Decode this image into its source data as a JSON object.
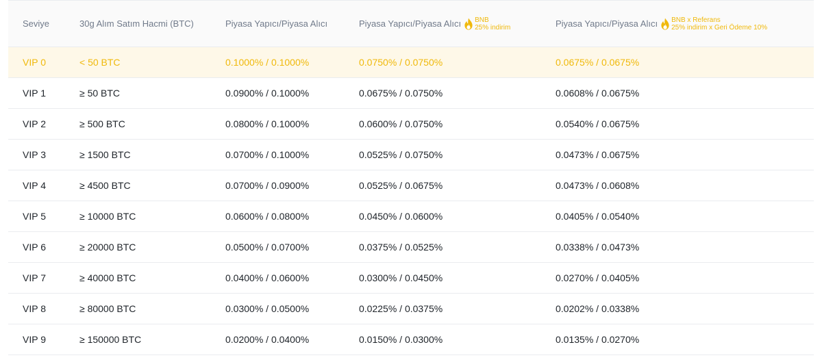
{
  "header": {
    "level": "Seviye",
    "volume": "30g Alım Satım Hacmi (BTC)",
    "maker_taker": "Piyasa Yapıcı/Piyasa Alıcı",
    "maker_taker_bnb": "Piyasa Yapıcı/Piyasa Alıcı",
    "bnb_badge_line1": "BNB",
    "bnb_badge_line2": "25% indirim",
    "maker_taker_ref": "Piyasa Yapıcı/Piyasa Alıcı",
    "ref_badge_line1": "BNB x Referans",
    "ref_badge_line2": "25% indirim x Geri Ödeme 10%"
  },
  "colors": {
    "highlight_bg": "#fef8e8",
    "accent": "#f0b90b",
    "muted": "#707a8a"
  },
  "icons": {
    "badge": "fire-icon"
  },
  "rows": [
    {
      "level": "VIP 0",
      "volume": "< 50 BTC",
      "fee": "0.1000% / 0.1000%",
      "bnb": "0.0750% / 0.0750%",
      "ref": "0.0675% / 0.0675%"
    },
    {
      "level": "VIP 1",
      "volume": "≥ 50 BTC",
      "fee": "0.0900% / 0.1000%",
      "bnb": "0.0675% / 0.0750%",
      "ref": "0.0608% / 0.0675%"
    },
    {
      "level": "VIP 2",
      "volume": "≥ 500 BTC",
      "fee": "0.0800% / 0.1000%",
      "bnb": "0.0600% / 0.0750%",
      "ref": "0.0540% / 0.0675%"
    },
    {
      "level": "VIP 3",
      "volume": "≥ 1500 BTC",
      "fee": "0.0700% / 0.1000%",
      "bnb": "0.0525% / 0.0750%",
      "ref": "0.0473% / 0.0675%"
    },
    {
      "level": "VIP 4",
      "volume": "≥ 4500 BTC",
      "fee": "0.0700% / 0.0900%",
      "bnb": "0.0525% / 0.0675%",
      "ref": "0.0473% / 0.0608%"
    },
    {
      "level": "VIP 5",
      "volume": "≥ 10000 BTC",
      "fee": "0.0600% / 0.0800%",
      "bnb": "0.0450% / 0.0600%",
      "ref": "0.0405% / 0.0540%"
    },
    {
      "level": "VIP 6",
      "volume": "≥ 20000 BTC",
      "fee": "0.0500% / 0.0700%",
      "bnb": "0.0375% / 0.0525%",
      "ref": "0.0338% / 0.0473%"
    },
    {
      "level": "VIP 7",
      "volume": "≥ 40000 BTC",
      "fee": "0.0400% / 0.0600%",
      "bnb": "0.0300% / 0.0450%",
      "ref": "0.0270% / 0.0405%"
    },
    {
      "level": "VIP 8",
      "volume": "≥ 80000 BTC",
      "fee": "0.0300% / 0.0500%",
      "bnb": "0.0225% / 0.0375%",
      "ref": "0.0202% / 0.0338%"
    },
    {
      "level": "VIP 9",
      "volume": "≥ 150000 BTC",
      "fee": "0.0200% / 0.0400%",
      "bnb": "0.0150% / 0.0300%",
      "ref": "0.0135% / 0.0270%"
    }
  ]
}
